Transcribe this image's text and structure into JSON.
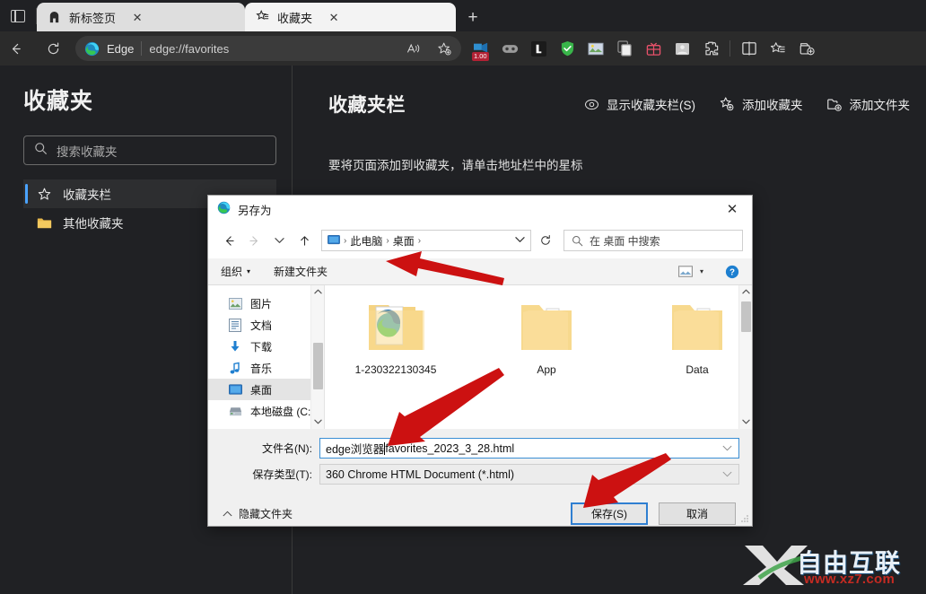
{
  "browser": {
    "tabs": [
      {
        "title": "新标签页",
        "icon": "edge-newtab-icon",
        "active": false,
        "close_label": "✕"
      },
      {
        "title": "收藏夹",
        "icon": "favorites-star-icon",
        "active": true,
        "close_label": "✕"
      }
    ],
    "new_tab_label": "+",
    "tab_search_icon": "tab-search-icon",
    "nav": {
      "back_icon": "back-arrow-icon",
      "reload_icon": "reload-icon",
      "brand_label": "Edge",
      "brand_icon": "edge-logo-icon",
      "url": "edge://favorites",
      "read_aloud_icon": "read-aloud-icon",
      "add-favorite_icon": "add-favorite-icon"
    },
    "extensions": [
      {
        "name": "video-speed-extension",
        "badge": "1.00"
      },
      {
        "name": "glasses-extension",
        "badge": ""
      },
      {
        "name": "lastpass-extension",
        "badge": ""
      },
      {
        "name": "shield-extension",
        "badge": ""
      },
      {
        "name": "image-extension",
        "badge": ""
      },
      {
        "name": "copy-extension",
        "badge": ""
      },
      {
        "name": "gift-extension",
        "badge": ""
      },
      {
        "name": "picture-extension",
        "badge": ""
      },
      {
        "name": "extensions-puzzle-icon",
        "badge": ""
      },
      {
        "name": "split-screen-icon",
        "badge": ""
      },
      {
        "name": "favorites-icon",
        "badge": ""
      },
      {
        "name": "collections-icon",
        "badge": ""
      }
    ]
  },
  "sidebar": {
    "title": "收藏夹",
    "search_placeholder": "搜索收藏夹",
    "search_icon": "search-icon",
    "items": [
      {
        "label": "收藏夹栏",
        "icon": "star-icon",
        "selected": true
      },
      {
        "label": "其他收藏夹",
        "icon": "folder-icon",
        "selected": false
      }
    ]
  },
  "main": {
    "title": "收藏夹栏",
    "actions": [
      {
        "label": "显示收藏夹栏(S)",
        "icon": "toggle-visibility-icon"
      },
      {
        "label": "添加收藏夹",
        "icon": "add-favorite-icon"
      },
      {
        "label": "添加文件夹",
        "icon": "add-folder-icon"
      }
    ],
    "hint": "要将页面添加到收藏夹，请单击地址栏中的星标"
  },
  "dialog": {
    "title": "另存为",
    "title_icon": "edge-logo-icon",
    "close_label": "✕",
    "nav": {
      "back_icon": "back-arrow-icon",
      "forward_icon": "forward-arrow-icon",
      "recent_icon": "chevron-down-icon",
      "up_icon": "up-arrow-icon",
      "breadcrumb_icon": "desktop-icon",
      "breadcrumbs": [
        "此电脑",
        "桌面"
      ],
      "breadcrumb_separator": "›",
      "dropdown_icon": "chevron-down-icon",
      "refresh_icon": "refresh-icon",
      "search_icon": "search-icon",
      "search_placeholder": "在 桌面 中搜索"
    },
    "toolbar": {
      "organize_label": "组织",
      "organize_caret": "▾",
      "new_folder_label": "新建文件夹",
      "view_icon": "view-layout-icon",
      "view_caret": "▾",
      "help_icon": "help-icon"
    },
    "tree": [
      {
        "label": "图片",
        "icon": "pictures-icon",
        "selected": false
      },
      {
        "label": "文档",
        "icon": "documents-icon",
        "selected": false
      },
      {
        "label": "下载",
        "icon": "downloads-icon",
        "selected": false
      },
      {
        "label": "音乐",
        "icon": "music-icon",
        "selected": false
      },
      {
        "label": "桌面",
        "icon": "desktop-icon",
        "selected": true
      },
      {
        "label": "本地磁盘 (C:)",
        "icon": "drive-icon",
        "selected": false
      }
    ],
    "files": [
      {
        "label": "1-230322130345",
        "icon": "folder-with-edge-icon"
      },
      {
        "label": "App",
        "icon": "folder-icon"
      },
      {
        "label": "Data",
        "icon": "folder-icon"
      }
    ],
    "fields": {
      "filename_label": "文件名(N):",
      "filename_value_prefix": "edge浏览器",
      "filename_value_suffix": "favorites_2023_3_28.html",
      "filetype_label": "保存类型(T):",
      "filetype_value": "360 Chrome HTML Document (*.html)",
      "dropdown_icon": "chevron-down-icon"
    },
    "footer": {
      "hide_folders_label": "隐藏文件夹",
      "hide_folders_icon": "chevron-up-icon",
      "save_label": "保存(S)",
      "cancel_label": "取消"
    },
    "scrollbar": {
      "up_arrow": "⌃",
      "down_arrow": "⌄"
    }
  },
  "watermark": {
    "text_cn": "自由互联",
    "url": "www.xz7.com"
  },
  "colors": {
    "page_bg": "#202124",
    "accent_blue": "#4aa3ff",
    "dialog_bg": "#f0f0f0",
    "button_border_focus": "#2f7fd1",
    "arrow_red": "#cc1111",
    "folder_yellow": "#fbd97a",
    "watermark_red": "#c42b22"
  }
}
